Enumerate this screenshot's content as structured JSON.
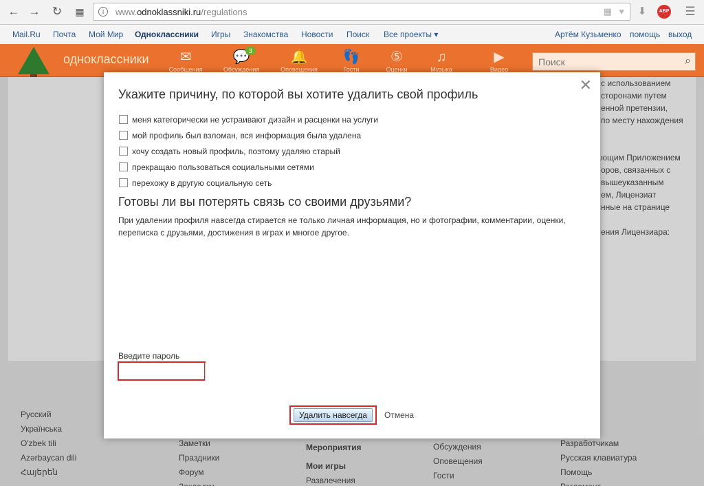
{
  "browser": {
    "url_prefix": "www.",
    "url_domain": "odnoklassniki.ru",
    "url_path": "/regulations",
    "icons": {
      "back": "back-arrow-icon",
      "forward": "forward-arrow-icon",
      "reload": "reload-icon",
      "apps": "apps-grid-icon",
      "page_info": "page-info-icon",
      "bookmark": "heart-icon",
      "download": "download-icon",
      "adblock": "adblock-icon",
      "menu": "menu-icon"
    },
    "adblock_label": "ABP"
  },
  "mailru_bar": {
    "links": [
      "Mail.Ru",
      "Почта",
      "Мой Мир",
      "Одноклассники",
      "Игры",
      "Знакомства",
      "Новости",
      "Поиск",
      "Все проекты ▾"
    ],
    "user": "Артём Кузьменко",
    "help": "помощь",
    "logout": "выход"
  },
  "ok_header": {
    "logo": "одноклассники",
    "nav": [
      {
        "label": "Сообщения",
        "icon": "envelope-icon"
      },
      {
        "label": "Обсуждения",
        "icon": "speech-bubbles-icon",
        "badge": "3"
      },
      {
        "label": "Оповещения",
        "icon": "bell-icon"
      },
      {
        "label": "Гости",
        "icon": "footprints-icon"
      },
      {
        "label": "Оценки",
        "icon": "rating-five-icon"
      },
      {
        "label": "Музыка",
        "icon": "music-note-icon"
      },
      {
        "label": "Видео",
        "icon": "video-icon"
      }
    ],
    "search_placeholder": "Поиск",
    "accent_color": "#eb722e"
  },
  "background_page": {
    "right_text": [
      "с использованием",
      "сторонами путем",
      "енной претензии,",
      "по месту нахождения",
      "",
      "",
      "ющим Приложением",
      "оров, связанных с",
      "вышеуказанным",
      "ем, Лицензиат",
      "нные на странице",
      "",
      "ения Лицензиара:"
    ],
    "footer_cols": [
      [
        "Русский",
        "Українська",
        "O'zbek tili",
        "Azərbaycan dili",
        "Հայերեն"
      ],
      [
        "",
        "",
        "Заметки",
        "Праздники",
        "Форум",
        "Закладки"
      ],
      [
        "",
        "",
        "Мероприятия",
        "",
        "Мои игры",
        "Развлечения"
      ],
      [
        "",
        "",
        "Обсуждения",
        "Оповещения",
        "Гости"
      ],
      [
        "я версия",
        "",
        "Разработчикам",
        "Русская клавиатура",
        "Помощь",
        "Регламент"
      ]
    ]
  },
  "modal": {
    "title": "Укажите причину, по которой вы хотите удалить свой профиль",
    "reasons": [
      "меня категорически не устраивают дизайн и расценки на услуги",
      "мой профиль был взломан, вся информация была удалена",
      "хочу создать новый профиль, поэтому удаляю старый",
      "прекращаю пользоваться социальными сетями",
      "перехожу в другую социальную сеть"
    ],
    "subtitle": "Готовы ли вы потерять связь со своими друзьями?",
    "description": "При удалении профиля навсегда стирается не только личная информация, но и фотографии, комментарии, оценки, переписка с друзьями, достижения в играх и многое другое.",
    "password_label": "Введите пароль",
    "password_value": "",
    "delete_button": "Удалить навсегда",
    "cancel_link": "Отмена",
    "close_icon": "close-icon",
    "highlight_color": "#d0282c"
  }
}
